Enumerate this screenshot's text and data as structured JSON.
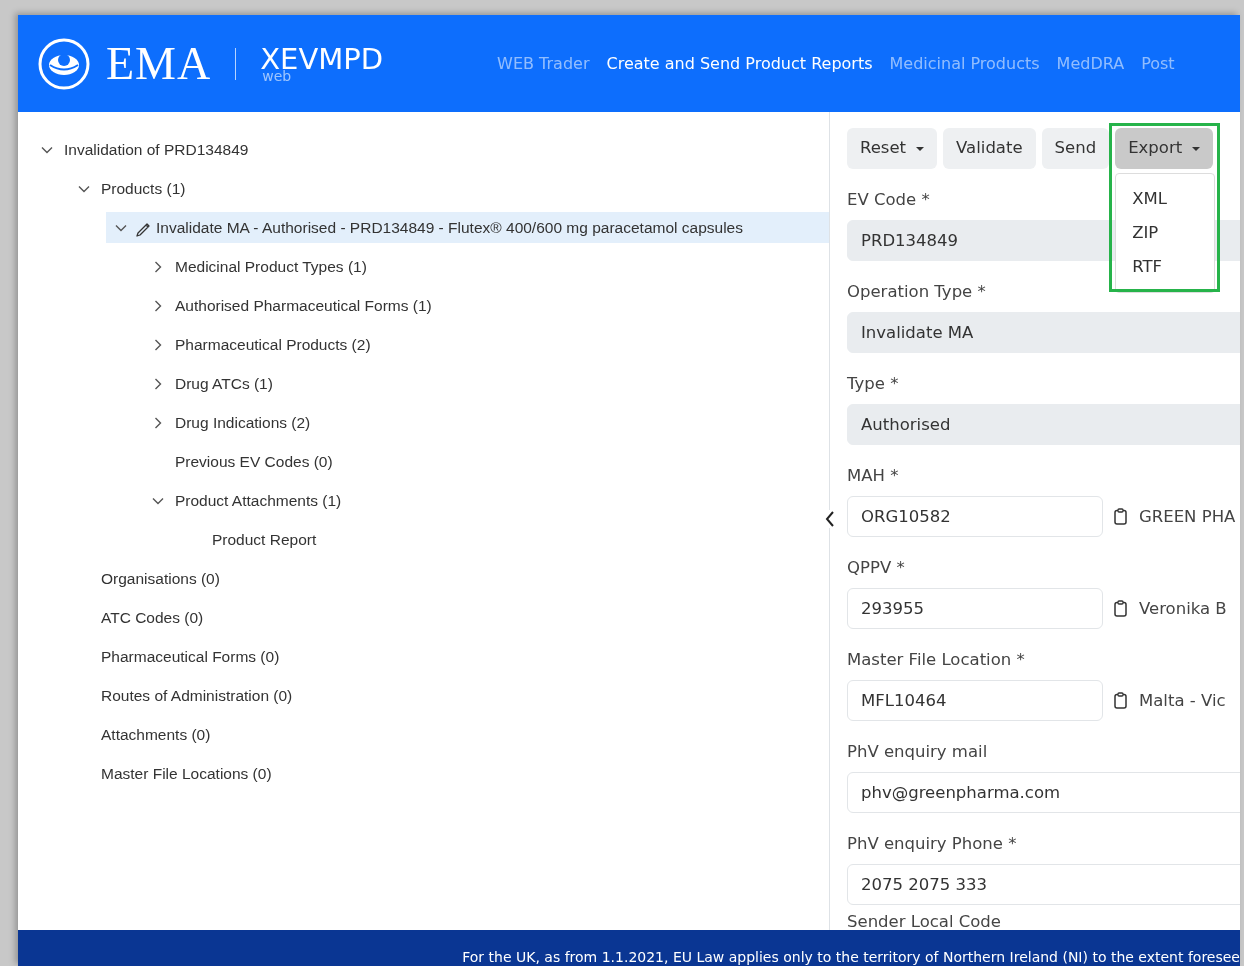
{
  "header": {
    "logo_text": "EMA",
    "product": "XEVMPD",
    "product_sub": "web",
    "nav": [
      {
        "label": "WEB Trader",
        "selected": false
      },
      {
        "label": "Create and Send Product Reports",
        "selected": true
      },
      {
        "label": "Medicinal Products",
        "selected": false
      },
      {
        "label": "MedDRA",
        "selected": false
      },
      {
        "label": "Post",
        "selected": false
      }
    ]
  },
  "tree": [
    {
      "label": "Invalidation of PRD134849",
      "kind": "branch",
      "expanded": true,
      "selected": false,
      "children": [
        {
          "label": "Products (1)",
          "kind": "branch",
          "expanded": true,
          "selected": false,
          "children": [
            {
              "label": "Invalidate MA - Authorised - PRD134849 - Flutex® 400/600 mg paracetamol capsules",
              "kind": "branch",
              "expanded": true,
              "selected": true,
              "children": [
                {
                  "label": "Medicinal Product Types (1)",
                  "kind": "branch",
                  "expanded": false,
                  "selected": false
                },
                {
                  "label": "Authorised Pharmaceutical Forms (1)",
                  "kind": "branch",
                  "expanded": false,
                  "selected": false
                },
                {
                  "label": "Pharmaceutical Products (2)",
                  "kind": "branch",
                  "expanded": false,
                  "selected": false
                },
                {
                  "label": "Drug ATCs (1)",
                  "kind": "branch",
                  "expanded": false,
                  "selected": false
                },
                {
                  "label": "Drug Indications (2)",
                  "kind": "branch",
                  "expanded": false,
                  "selected": false
                },
                {
                  "label": "Previous EV Codes (0)",
                  "kind": "leaf",
                  "selected": false
                },
                {
                  "label": "Product Attachments (1)",
                  "kind": "branch",
                  "expanded": true,
                  "selected": false,
                  "children": [
                    {
                      "label": "Product Report",
                      "kind": "leaf",
                      "selected": false
                    }
                  ]
                }
              ]
            }
          ]
        },
        {
          "label": "Organisations (0)",
          "kind": "leaf",
          "selected": false
        },
        {
          "label": "ATC Codes (0)",
          "kind": "leaf",
          "selected": false
        },
        {
          "label": "Pharmaceutical Forms (0)",
          "kind": "leaf",
          "selected": false
        },
        {
          "label": "Routes of Administration (0)",
          "kind": "leaf",
          "selected": false
        },
        {
          "label": "Attachments (0)",
          "kind": "leaf",
          "selected": false
        },
        {
          "label": "Master File Locations (0)",
          "kind": "leaf",
          "selected": false
        }
      ]
    }
  ],
  "toolbar": [
    {
      "label": "Reset",
      "kind": "dropdown",
      "active": false
    },
    {
      "label": "Validate",
      "kind": "plain",
      "active": false
    },
    {
      "label": "Send",
      "kind": "plain",
      "active": false
    },
    {
      "label": "Export",
      "kind": "dropdown",
      "active": true,
      "highlighted": true,
      "menu": [
        "XML",
        "ZIP",
        "RTF"
      ]
    }
  ],
  "fields": [
    {
      "label": "EV Code *",
      "value": "PRD134849",
      "readonly": true
    },
    {
      "label": "Operation Type *",
      "value": "Invalidate MA",
      "readonly": true
    },
    {
      "label": "Type *",
      "value": "Authorised",
      "readonly": true
    },
    {
      "label": "MAH *",
      "value": "ORG10582",
      "readonly": false,
      "lookup": "GREEN PHA"
    },
    {
      "label": "QPPV *",
      "value": "293955",
      "readonly": false,
      "lookup": "Veronika B"
    },
    {
      "label": "Master File Location *",
      "value": "MFL10464",
      "readonly": false,
      "lookup": "Malta - Vic"
    },
    {
      "label": "PhV enquiry mail",
      "value": "phv@greenpharma.com",
      "readonly": false
    },
    {
      "label": "PhV enquiry Phone *",
      "value": "2075 2075 333",
      "readonly": false
    }
  ],
  "trailing_label": "Sender Local Code",
  "footer": "For the UK, as from 1.1.2021, EU Law applies only to the territory of Northern Ireland (NI) to the extent foresee"
}
